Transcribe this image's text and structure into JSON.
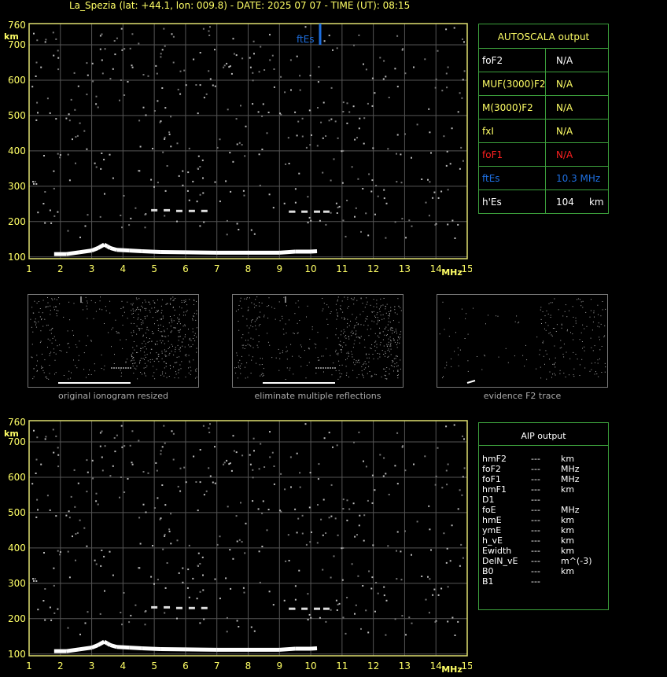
{
  "header": {
    "title": "La_Spezia (lat: +44.1, lon: 009.8) - DATE: 2025 07 07 - TIME (UT): 08:15"
  },
  "colors": {
    "grid": "#555555",
    "frame": "#e0e070",
    "axis_text": "#ffff66",
    "panel_border": "#3ca03c",
    "fte": "#1e6fe0",
    "fof1": "#ff2020",
    "trace": "#ffffff"
  },
  "autoscala": {
    "title": "AUTOSCALA output",
    "rows": [
      {
        "key": "foF2",
        "value": "N/A",
        "color": "#ffffff"
      },
      {
        "key": "MUF(3000)F2",
        "value": "N/A",
        "color": "#ffff66"
      },
      {
        "key": "M(3000)F2",
        "value": "N/A",
        "color": "#ffff66"
      },
      {
        "key": "fxI",
        "value": "N/A",
        "color": "#ffff66"
      },
      {
        "key": "foF1",
        "value": "N/A",
        "color": "#ff2020"
      },
      {
        "key": "ftEs",
        "value": "10.3 MHz",
        "color": "#1e6fe0"
      },
      {
        "key": "h'Es",
        "value": "104     km",
        "color": "#ffffff"
      }
    ]
  },
  "aip": {
    "title": "AIP output",
    "rows": [
      {
        "param": "hmF2",
        "value": "---",
        "unit": "km"
      },
      {
        "param": "foF2",
        "value": "---",
        "unit": "MHz"
      },
      {
        "param": "foF1",
        "value": "---",
        "unit": "MHz"
      },
      {
        "param": "hmF1",
        "value": "---",
        "unit": "km"
      },
      {
        "param": "D1",
        "value": "---",
        "unit": ""
      },
      {
        "param": "foE",
        "value": "---",
        "unit": "MHz"
      },
      {
        "param": "hmE",
        "value": "---",
        "unit": "km"
      },
      {
        "param": "ymE",
        "value": "---",
        "unit": "km"
      },
      {
        "param": "h_vE",
        "value": "---",
        "unit": "km"
      },
      {
        "param": "Ewidth",
        "value": "---",
        "unit": "km"
      },
      {
        "param": "DelN_vE",
        "value": "---",
        "unit": "m^(-3)"
      },
      {
        "param": "B0",
        "value": "---",
        "unit": "km"
      },
      {
        "param": "B1",
        "value": "---",
        "unit": ""
      }
    ]
  },
  "thumbnails": [
    {
      "caption": "original ionogram resized"
    },
    {
      "caption": "eliminate multiple reflections"
    },
    {
      "caption": "evidence F2 trace"
    }
  ],
  "chart_data": [
    {
      "type": "scatter",
      "xlabel": "MHz",
      "ylabel": "km",
      "xlim": [
        1,
        15
      ],
      "ylim": [
        95,
        760
      ],
      "x_ticks": [
        1,
        2,
        3,
        4,
        5,
        6,
        7,
        8,
        9,
        10,
        11,
        12,
        13,
        14,
        15
      ],
      "y_ticks": [
        100,
        200,
        300,
        400,
        500,
        600,
        700,
        760
      ],
      "grid": true,
      "fte_marker": {
        "label": "ftEs",
        "x": 10.3,
        "y_from": 700,
        "y_to": 760
      },
      "trace": [
        [
          1.8,
          108
        ],
        [
          2.2,
          108
        ],
        [
          2.6,
          113
        ],
        [
          3.0,
          118
        ],
        [
          3.2,
          125
        ],
        [
          3.4,
          135
        ],
        [
          3.5,
          130
        ],
        [
          3.6,
          125
        ],
        [
          3.8,
          120
        ],
        [
          4.2,
          118
        ],
        [
          4.6,
          116
        ],
        [
          5.2,
          114
        ],
        [
          6.0,
          113
        ],
        [
          7.0,
          112
        ],
        [
          8.0,
          112
        ],
        [
          9.0,
          112
        ],
        [
          9.5,
          115
        ],
        [
          10.0,
          115
        ],
        [
          10.2,
          116
        ]
      ],
      "es_upper": [
        [
          5.0,
          232
        ],
        [
          5.4,
          232
        ],
        [
          5.8,
          230
        ],
        [
          6.2,
          230
        ],
        [
          6.6,
          230
        ],
        [
          9.4,
          228
        ],
        [
          9.8,
          228
        ],
        [
          10.2,
          228
        ],
        [
          10.5,
          228
        ]
      ]
    }
  ]
}
